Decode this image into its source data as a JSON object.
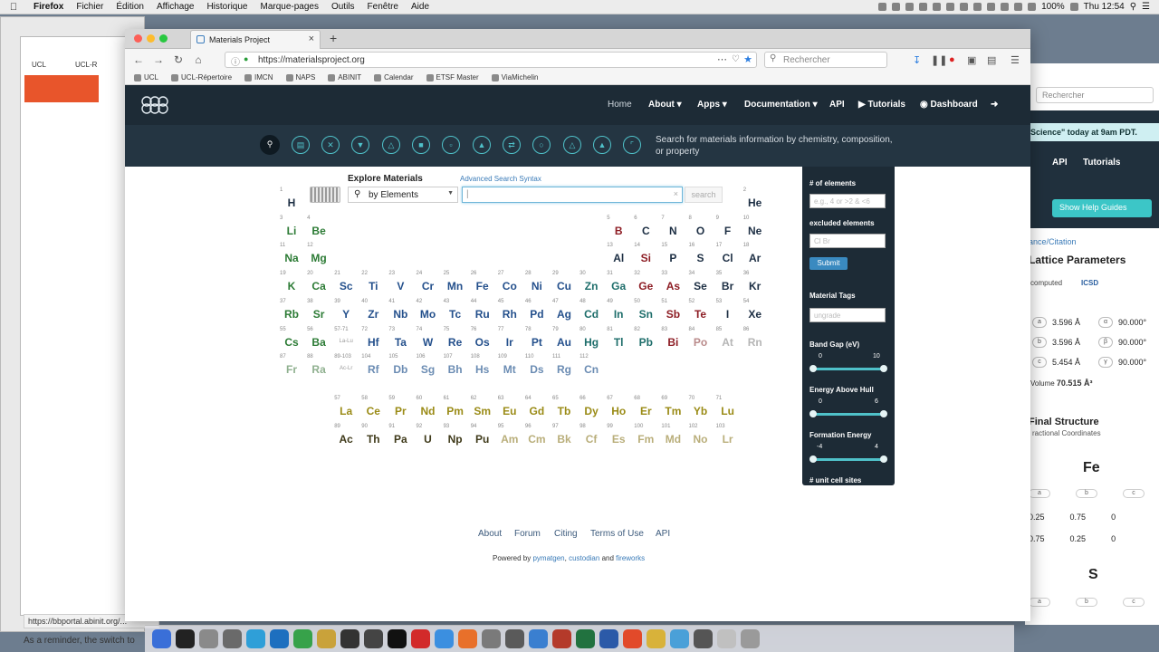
{
  "menubar": {
    "app": "Firefox",
    "items": [
      "Fichier",
      "Édition",
      "Affichage",
      "Historique",
      "Marque-pages",
      "Outils",
      "Fenêtre",
      "Aide"
    ],
    "battery": "100%",
    "clock": "Thu 12:54"
  },
  "background_left": {
    "bookmark_1": "UCL",
    "bookmark_2": "UCL-R",
    "status_link": "https://bbportal.abinit.org/...",
    "reminder": "As a reminder, the switch to"
  },
  "background_right": {
    "search_placeholder": "Rechercher",
    "banner": "Science\" today at 9am PDT.",
    "nav_api": "API",
    "nav_tutorials": "Tutorials",
    "help_button": "Show Help Guides",
    "citation_link": "ance/Citation",
    "lattice_title": "Lattice Parameters",
    "computed": "computed",
    "icsd": "ICSD",
    "lattice_rows": [
      {
        "p": "a",
        "v": "3.596 Å",
        "ap": "α",
        "av": "90.000°"
      },
      {
        "p": "b",
        "v": "3.596 Å",
        "ap": "β",
        "av": "90.000°"
      },
      {
        "p": "c",
        "v": "5.454 Å",
        "ap": "γ",
        "av": "90.000°"
      }
    ],
    "volume_label": "Volume",
    "volume_value": "70.515 Å³",
    "final_structure": "Final Structure",
    "fractional": "ractional Coordinates",
    "atom1": "Fe",
    "atom2": "S",
    "coords": [
      [
        "0.25",
        "0.75",
        "0"
      ],
      [
        "0.75",
        "0.25",
        "0"
      ]
    ],
    "abc": [
      "a",
      "b",
      "c"
    ]
  },
  "browser": {
    "tab_title": "Materials Project",
    "url": "https://materialsproject.org",
    "search_placeholder": "Rechercher",
    "bookmarks": [
      "UCL",
      "UCL-Répertoire",
      "IMCN",
      "NAPS",
      "ABINIT",
      "Calendar",
      "ETSF Master",
      "ViaMichelin"
    ]
  },
  "site": {
    "nav": {
      "home": "Home",
      "about": "About",
      "apps": "Apps",
      "documentation": "Documentation",
      "api": "API",
      "tutorials": "Tutorials",
      "dashboard": "Dashboard"
    },
    "tool_icons": [
      "search-icon",
      "database-icon",
      "tools-icon",
      "pourbaix-icon",
      "phase-diagram-icon",
      "nanoporous-icon",
      "battery-icon",
      "flask-icon",
      "reaction-icon",
      "crystal-icon",
      "molecule-icon",
      "aqueous-icon",
      "chart-icon"
    ],
    "search_hint": "Search for materials information by chemistry, composition, or property",
    "explore_title": "Explore Materials",
    "advanced_link": "Advanced Search Syntax",
    "mode_selector": "by Elements",
    "search_value": "",
    "search_button": "search",
    "filters": {
      "num_elements_label": "# of elements",
      "num_elements_placeholder": "e.g., 4 or >2 & <6",
      "excluded_label": "excluded elements",
      "excluded_placeholder": "Cl Br",
      "submit": "Submit",
      "tags_label": "Material Tags",
      "tags_placeholder": "ungrade",
      "band_gap_label": "Band Gap (eV)",
      "band_gap_range": [
        "0",
        "10"
      ],
      "ehull_label": "Energy Above Hull",
      "ehull_range": [
        "0",
        "6"
      ],
      "formation_label": "Formation Energy",
      "formation_range": [
        "-4",
        "4"
      ],
      "sites_label": "# unit cell sites"
    },
    "footer_links": [
      "About",
      "Forum",
      "Citing",
      "Terms of Use",
      "API"
    ],
    "powered_prefix": "Powered by",
    "powered_links": [
      "pymatgen",
      "custodian",
      "fireworks"
    ],
    "powered_and": "and"
  },
  "periodic_table": {
    "placeholders": [
      {
        "label": "57-71",
        "sym": "La-Lu",
        "color": "#999999"
      },
      {
        "label": "89-103",
        "sym": "Ac-Lr",
        "color": "#999999"
      }
    ],
    "elements": [
      {
        "n": "1",
        "s": "H",
        "color": "#1d2f44"
      },
      {
        "n": "2",
        "s": "He",
        "color": "#1d2f44"
      },
      {
        "n": "3",
        "s": "Li",
        "color": "#2c7b35"
      },
      {
        "n": "4",
        "s": "Be",
        "color": "#2c7b35"
      },
      {
        "n": "5",
        "s": "B",
        "color": "#8d1d24"
      },
      {
        "n": "6",
        "s": "C",
        "color": "#1d2f44"
      },
      {
        "n": "7",
        "s": "N",
        "color": "#1d2f44"
      },
      {
        "n": "8",
        "s": "O",
        "color": "#1d2f44"
      },
      {
        "n": "9",
        "s": "F",
        "color": "#1d2f44"
      },
      {
        "n": "10",
        "s": "Ne",
        "color": "#1d2f44"
      },
      {
        "n": "11",
        "s": "Na",
        "color": "#2c7b35"
      },
      {
        "n": "12",
        "s": "Mg",
        "color": "#2c7b35"
      },
      {
        "n": "13",
        "s": "Al",
        "color": "#1d2f44"
      },
      {
        "n": "14",
        "s": "Si",
        "color": "#8d1d24"
      },
      {
        "n": "15",
        "s": "P",
        "color": "#1d2f44"
      },
      {
        "n": "16",
        "s": "S",
        "color": "#1d2f44"
      },
      {
        "n": "17",
        "s": "Cl",
        "color": "#1d2f44"
      },
      {
        "n": "18",
        "s": "Ar",
        "color": "#1d2f44"
      },
      {
        "n": "19",
        "s": "K",
        "color": "#2c7b35"
      },
      {
        "n": "20",
        "s": "Ca",
        "color": "#2c7b35"
      },
      {
        "n": "21",
        "s": "Sc",
        "color": "#24508c"
      },
      {
        "n": "22",
        "s": "Ti",
        "color": "#24508c"
      },
      {
        "n": "23",
        "s": "V",
        "color": "#24508c"
      },
      {
        "n": "24",
        "s": "Cr",
        "color": "#24508c"
      },
      {
        "n": "25",
        "s": "Mn",
        "color": "#24508c"
      },
      {
        "n": "26",
        "s": "Fe",
        "color": "#24508c"
      },
      {
        "n": "27",
        "s": "Co",
        "color": "#24508c"
      },
      {
        "n": "28",
        "s": "Ni",
        "color": "#24508c"
      },
      {
        "n": "29",
        "s": "Cu",
        "color": "#24508c"
      },
      {
        "n": "30",
        "s": "Zn",
        "color": "#1e6e6b"
      },
      {
        "n": "31",
        "s": "Ga",
        "color": "#1e6e6b"
      },
      {
        "n": "32",
        "s": "Ge",
        "color": "#8d1d24"
      },
      {
        "n": "33",
        "s": "As",
        "color": "#8d1d24"
      },
      {
        "n": "34",
        "s": "Se",
        "color": "#1d2f44"
      },
      {
        "n": "35",
        "s": "Br",
        "color": "#1d2f44"
      },
      {
        "n": "36",
        "s": "Kr",
        "color": "#1d2f44"
      },
      {
        "n": "37",
        "s": "Rb",
        "color": "#2c7b35"
      },
      {
        "n": "38",
        "s": "Sr",
        "color": "#2c7b35"
      },
      {
        "n": "39",
        "s": "Y",
        "color": "#24508c"
      },
      {
        "n": "40",
        "s": "Zr",
        "color": "#24508c"
      },
      {
        "n": "41",
        "s": "Nb",
        "color": "#24508c"
      },
      {
        "n": "42",
        "s": "Mo",
        "color": "#24508c"
      },
      {
        "n": "43",
        "s": "Tc",
        "color": "#24508c"
      },
      {
        "n": "44",
        "s": "Ru",
        "color": "#24508c"
      },
      {
        "n": "45",
        "s": "Rh",
        "color": "#24508c"
      },
      {
        "n": "46",
        "s": "Pd",
        "color": "#24508c"
      },
      {
        "n": "47",
        "s": "Ag",
        "color": "#24508c"
      },
      {
        "n": "48",
        "s": "Cd",
        "color": "#1e6e6b"
      },
      {
        "n": "49",
        "s": "In",
        "color": "#1e6e6b"
      },
      {
        "n": "50",
        "s": "Sn",
        "color": "#1e6e6b"
      },
      {
        "n": "51",
        "s": "Sb",
        "color": "#8d1d24"
      },
      {
        "n": "52",
        "s": "Te",
        "color": "#8d1d24"
      },
      {
        "n": "53",
        "s": "I",
        "color": "#1d2f44"
      },
      {
        "n": "54",
        "s": "Xe",
        "color": "#1d2f44"
      },
      {
        "n": "55",
        "s": "Cs",
        "color": "#2c7b35"
      },
      {
        "n": "56",
        "s": "Ba",
        "color": "#2c7b35"
      },
      {
        "n": "72",
        "s": "Hf",
        "color": "#24508c"
      },
      {
        "n": "73",
        "s": "Ta",
        "color": "#24508c"
      },
      {
        "n": "74",
        "s": "W",
        "color": "#24508c"
      },
      {
        "n": "75",
        "s": "Re",
        "color": "#24508c"
      },
      {
        "n": "76",
        "s": "Os",
        "color": "#24508c"
      },
      {
        "n": "77",
        "s": "Ir",
        "color": "#24508c"
      },
      {
        "n": "78",
        "s": "Pt",
        "color": "#24508c"
      },
      {
        "n": "79",
        "s": "Au",
        "color": "#24508c"
      },
      {
        "n": "80",
        "s": "Hg",
        "color": "#1e6e6b"
      },
      {
        "n": "81",
        "s": "Tl",
        "color": "#1e6e6b"
      },
      {
        "n": "82",
        "s": "Pb",
        "color": "#1e6e6b"
      },
      {
        "n": "83",
        "s": "Bi",
        "color": "#8d1d24"
      },
      {
        "n": "84",
        "s": "Po",
        "color": "#b98a8a"
      },
      {
        "n": "85",
        "s": "At",
        "color": "#b5b5b5"
      },
      {
        "n": "86",
        "s": "Rn",
        "color": "#b5b5b5"
      },
      {
        "n": "87",
        "s": "Fr",
        "color": "#8fb08f"
      },
      {
        "n": "88",
        "s": "Ra",
        "color": "#8fb08f"
      },
      {
        "n": "104",
        "s": "Rf",
        "color": "#6b8cb3"
      },
      {
        "n": "105",
        "s": "Db",
        "color": "#6b8cb3"
      },
      {
        "n": "106",
        "s": "Sg",
        "color": "#6b8cb3"
      },
      {
        "n": "107",
        "s": "Bh",
        "color": "#6b8cb3"
      },
      {
        "n": "108",
        "s": "Hs",
        "color": "#6b8cb3"
      },
      {
        "n": "109",
        "s": "Mt",
        "color": "#6b8cb3"
      },
      {
        "n": "110",
        "s": "Ds",
        "color": "#6b8cb3"
      },
      {
        "n": "111",
        "s": "Rg",
        "color": "#6b8cb3"
      },
      {
        "n": "112",
        "s": "Cn",
        "color": "#6b8cb3"
      },
      {
        "n": "57",
        "s": "La",
        "color": "#9a8b16"
      },
      {
        "n": "58",
        "s": "Ce",
        "color": "#9a8b16"
      },
      {
        "n": "59",
        "s": "Pr",
        "color": "#9a8b16"
      },
      {
        "n": "60",
        "s": "Nd",
        "color": "#9a8b16"
      },
      {
        "n": "61",
        "s": "Pm",
        "color": "#9a8b16"
      },
      {
        "n": "62",
        "s": "Sm",
        "color": "#9a8b16"
      },
      {
        "n": "63",
        "s": "Eu",
        "color": "#9a8b16"
      },
      {
        "n": "64",
        "s": "Gd",
        "color": "#9a8b16"
      },
      {
        "n": "65",
        "s": "Tb",
        "color": "#9a8b16"
      },
      {
        "n": "66",
        "s": "Dy",
        "color": "#9a8b16"
      },
      {
        "n": "67",
        "s": "Ho",
        "color": "#9a8b16"
      },
      {
        "n": "68",
        "s": "Er",
        "color": "#9a8b16"
      },
      {
        "n": "69",
        "s": "Tm",
        "color": "#9a8b16"
      },
      {
        "n": "70",
        "s": "Yb",
        "color": "#9a8b16"
      },
      {
        "n": "71",
        "s": "Lu",
        "color": "#9a8b16"
      },
      {
        "n": "89",
        "s": "Ac",
        "color": "#3f3a1a"
      },
      {
        "n": "90",
        "s": "Th",
        "color": "#3f3a1a"
      },
      {
        "n": "91",
        "s": "Pa",
        "color": "#3f3a1a"
      },
      {
        "n": "92",
        "s": "U",
        "color": "#3f3a1a"
      },
      {
        "n": "93",
        "s": "Np",
        "color": "#3f3a1a"
      },
      {
        "n": "94",
        "s": "Pu",
        "color": "#3f3a1a"
      },
      {
        "n": "95",
        "s": "Am",
        "color": "#b9ae7a"
      },
      {
        "n": "96",
        "s": "Cm",
        "color": "#b9ae7a"
      },
      {
        "n": "97",
        "s": "Bk",
        "color": "#b9ae7a"
      },
      {
        "n": "98",
        "s": "Cf",
        "color": "#b9ae7a"
      },
      {
        "n": "99",
        "s": "Es",
        "color": "#b9ae7a"
      },
      {
        "n": "100",
        "s": "Fm",
        "color": "#b9ae7a"
      },
      {
        "n": "101",
        "s": "Md",
        "color": "#b9ae7a"
      },
      {
        "n": "102",
        "s": "No",
        "color": "#b9ae7a"
      },
      {
        "n": "103",
        "s": "Lr",
        "color": "#b9ae7a"
      }
    ]
  }
}
